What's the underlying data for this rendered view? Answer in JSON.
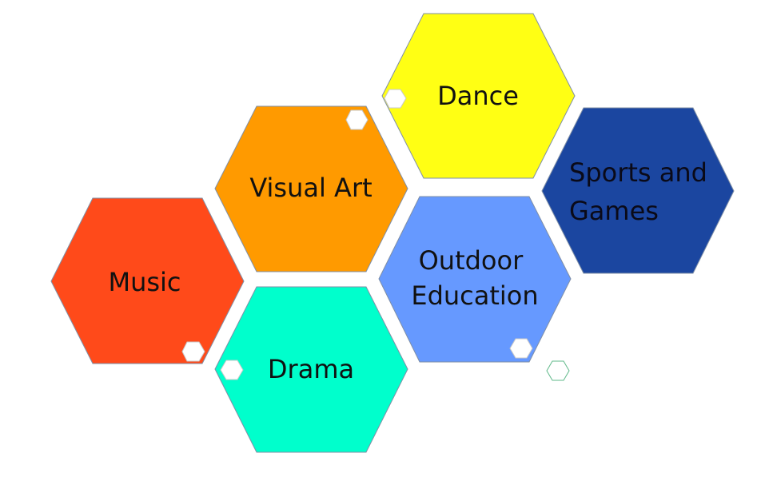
{
  "hexagons": [
    {
      "label_lines": [
        "Dance"
      ],
      "color": "#ffff14"
    },
    {
      "label_lines": [
        "Visual Art"
      ],
      "color": "#ff9a00"
    },
    {
      "label_lines": [
        "Sports and",
        "Games"
      ],
      "color": "#1b46a0"
    },
    {
      "label_lines": [
        "Music"
      ],
      "color": "#ff4a1a"
    },
    {
      "label_lines": [
        "Outdoor",
        "Education"
      ],
      "color": "#6699ff"
    },
    {
      "label_lines": [
        "Drama"
      ],
      "color": "#00ffcc"
    }
  ],
  "colors": {
    "small_hex_fill": "#ffffff",
    "small_hex_stroke": "#c8c8c8",
    "small_hex_outline_stroke": "#5fb98a",
    "hex_stroke": "#7f8fa6"
  }
}
